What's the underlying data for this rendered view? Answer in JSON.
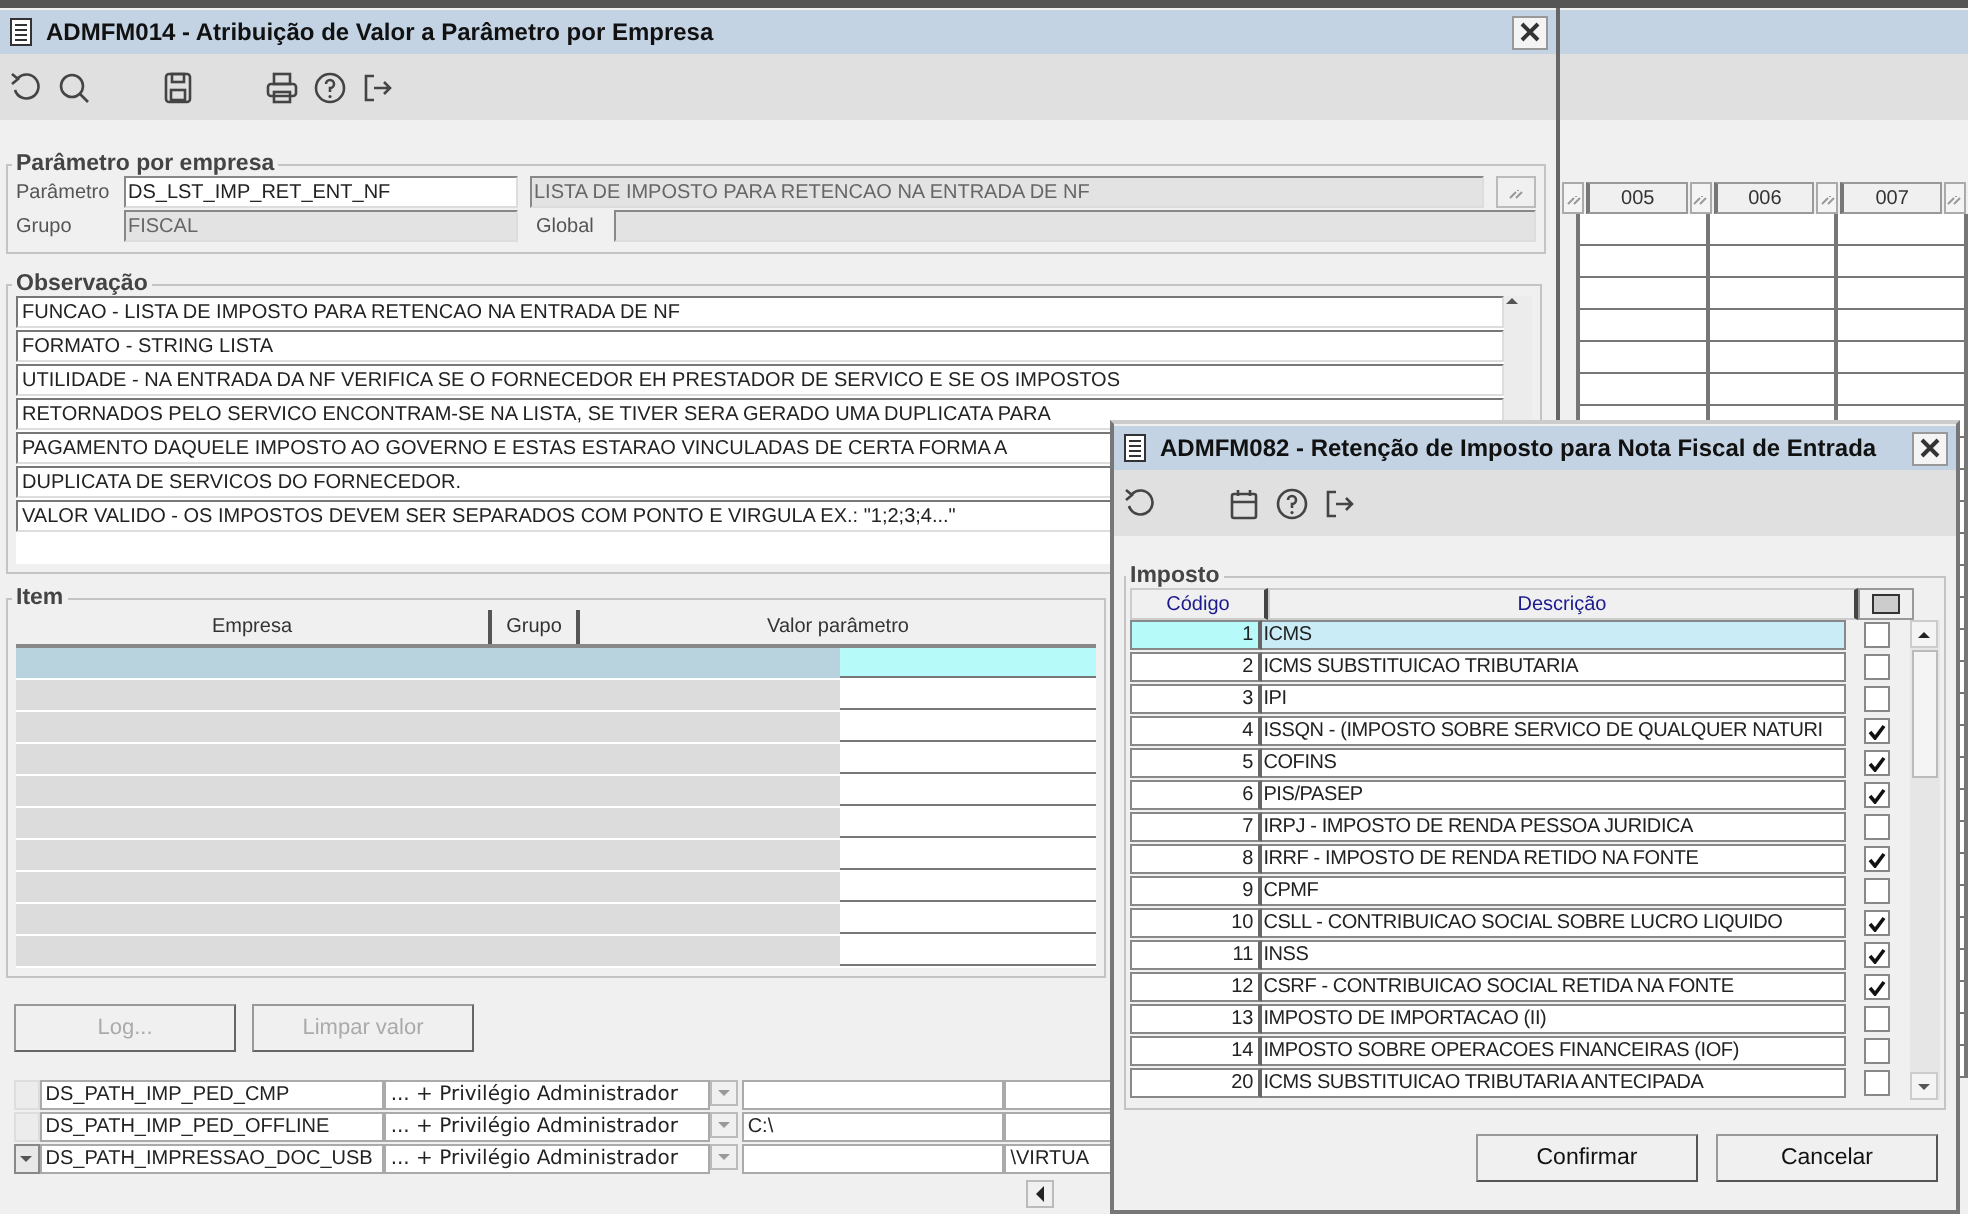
{
  "background_window": {
    "columns": [
      "005",
      "006",
      "007"
    ],
    "rows": [
      {
        "parameter": "DS_PATH_IMP_PED_CMP",
        "access": "... + Privilégio Administrador",
        "selected": false
      },
      {
        "parameter": "DS_PATH_IMP_PED_OFFLINE",
        "access": "... + Privilégio Administrador",
        "column_4": "C:\\",
        "selected": false
      },
      {
        "parameter": "DS_PATH_IMPRESSAO_DOC_USB",
        "access": "... + Privilégio Administrador",
        "column_5": "\\VIRTUA",
        "selected": true
      }
    ]
  },
  "main_window": {
    "title": "ADMFM014 - Atribuição de Valor a Parâmetro por Empresa",
    "parametro_group": {
      "legend": "Parâmetro por empresa",
      "parametro_label": "Parâmetro",
      "parametro_value": "DS_LST_IMP_RET_ENT_NF",
      "description_value": "LISTA DE IMPOSTO PARA RETENCAO NA ENTRADA DE NF",
      "grupo_label": "Grupo",
      "grupo_value": "FISCAL",
      "global_label": "Global"
    },
    "observacao": {
      "legend": "Observação",
      "lines": [
        "FUNCAO - LISTA DE IMPOSTO PARA RETENCAO NA ENTRADA DE NF",
        "FORMATO - STRING LISTA",
        "UTILIDADE - NA ENTRADA DA NF VERIFICA SE O FORNECEDOR EH PRESTADOR DE SERVICO E SE OS IMPOSTOS",
        "RETORNADOS PELO SERVICO ENCONTRAM-SE NA LISTA, SE TIVER SERA GERADO UMA DUPLICATA PARA",
        "PAGAMENTO DAQUELE IMPOSTO AO GOVERNO E ESTAS ESTARAO VINCULADAS DE CERTA FORMA A",
        "DUPLICATA DE SERVICOS DO FORNECEDOR.",
        "VALOR VALIDO - OS IMPOSTOS DEVEM SER SEPARADOS COM PONTO E VIRGULA EX.: \"1;2;3;4...\""
      ]
    },
    "item": {
      "legend": "Item",
      "columns": [
        "Empresa",
        "Grupo",
        "Valor parâmetro"
      ],
      "rows": [
        {
          "selected": true
        },
        {
          "selected": false
        },
        {
          "selected": false
        },
        {
          "selected": false
        },
        {
          "selected": false
        },
        {
          "selected": false
        },
        {
          "selected": false
        },
        {
          "selected": false
        },
        {
          "selected": false
        },
        {
          "selected": false
        }
      ]
    },
    "buttons": [
      {
        "label": "Log...",
        "disabled": true
      },
      {
        "label": "Limpar valor",
        "disabled": true
      }
    ]
  },
  "dialog": {
    "title": "ADMFM082 - Retenção de Imposto para Nota Fiscal de Entrada",
    "legend": "Imposto",
    "columns": [
      "Código",
      "Descrição"
    ],
    "rows": [
      {
        "code": "1",
        "description": "ICMS",
        "checked": false,
        "selected": true
      },
      {
        "code": "2",
        "description": "ICMS SUBSTITUICAO TRIBUTARIA",
        "checked": false,
        "selected": false
      },
      {
        "code": "3",
        "description": "IPI",
        "checked": false,
        "selected": false
      },
      {
        "code": "4",
        "description": "ISSQN - (IMPOSTO SOBRE SERVICO DE QUALQUER NATURI",
        "checked": true,
        "selected": false
      },
      {
        "code": "5",
        "description": "COFINS",
        "checked": true,
        "selected": false
      },
      {
        "code": "6",
        "description": "PIS/PASEP",
        "checked": true,
        "selected": false
      },
      {
        "code": "7",
        "description": "IRPJ - IMPOSTO DE RENDA PESSOA JURIDICA",
        "checked": false,
        "selected": false
      },
      {
        "code": "8",
        "description": "IRRF - IMPOSTO DE RENDA RETIDO NA FONTE",
        "checked": true,
        "selected": false
      },
      {
        "code": "9",
        "description": "CPMF",
        "checked": false,
        "selected": false
      },
      {
        "code": "10",
        "description": "CSLL - CONTRIBUICAO SOCIAL SOBRE LUCRO LIQUIDO",
        "checked": true,
        "selected": false
      },
      {
        "code": "11",
        "description": "INSS",
        "checked": true,
        "selected": false
      },
      {
        "code": "12",
        "description": "CSRF - CONTRIBUICAO SOCIAL RETIDA NA FONTE",
        "checked": true,
        "selected": false
      },
      {
        "code": "13",
        "description": "IMPOSTO DE IMPORTACAO (II)",
        "checked": false,
        "selected": false
      },
      {
        "code": "14",
        "description": "IMPOSTO SOBRE OPERACOES FINANCEIRAS (IOF)",
        "checked": false,
        "selected": false
      },
      {
        "code": "20",
        "description": "ICMS SUBSTITUICAO TRIBUTARIA ANTECIPADA",
        "checked": false,
        "selected": false
      }
    ],
    "buttons": [
      "Confirmar",
      "Cancelar"
    ]
  }
}
